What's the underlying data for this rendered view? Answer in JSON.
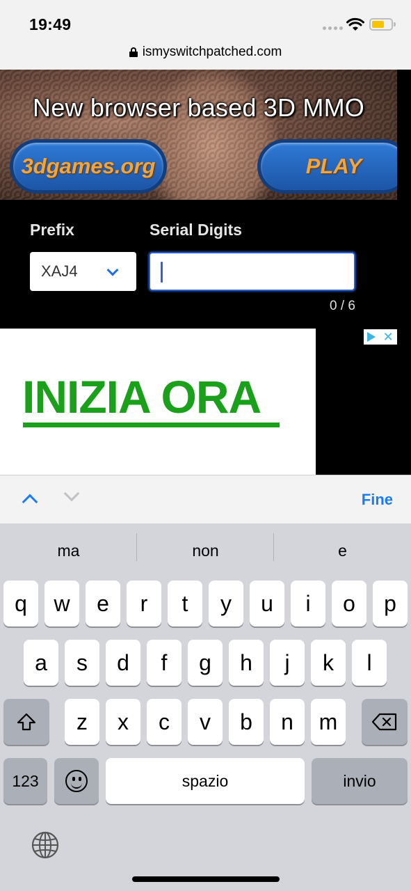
{
  "status_bar": {
    "time": "19:49"
  },
  "browser": {
    "url": "ismyswitchpatched.com"
  },
  "ad_top": {
    "headline": "New browser based 3D MMO",
    "left_button": "3dgames.org",
    "right_button": "PLAY"
  },
  "form": {
    "prefix_label": "Prefix",
    "serial_label": "Serial Digits",
    "prefix_value": "XAJ4",
    "serial_value": "",
    "counter": "0 / 6"
  },
  "ad_second": {
    "text": "INIZIA ORA"
  },
  "keyboard_toolbar": {
    "done_label": "Fine"
  },
  "keyboard": {
    "suggestions": [
      "ma",
      "non",
      "e"
    ],
    "row1": [
      "q",
      "w",
      "e",
      "r",
      "t",
      "y",
      "u",
      "i",
      "o",
      "p"
    ],
    "row2": [
      "a",
      "s",
      "d",
      "f",
      "g",
      "h",
      "j",
      "k",
      "l"
    ],
    "row3": [
      "z",
      "x",
      "c",
      "v",
      "b",
      "n",
      "m"
    ],
    "numbers_label": "123",
    "space_label": "spazio",
    "return_label": "invio"
  },
  "colors": {
    "accent": "#1b7cf2",
    "ad_green": "#1aa01a",
    "keyboard_bg": "#d3d5db"
  }
}
